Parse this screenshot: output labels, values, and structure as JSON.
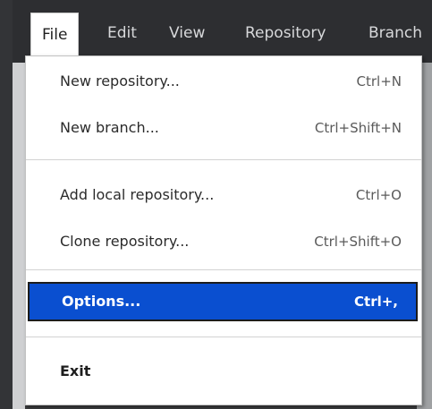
{
  "menubar": {
    "items": [
      {
        "label": "File"
      },
      {
        "label": "Edit"
      },
      {
        "label": "View"
      },
      {
        "label": "Repository"
      },
      {
        "label": "Branch"
      }
    ],
    "active_index": 0
  },
  "file_menu": {
    "items": [
      {
        "label": "New repository...",
        "shortcut": "Ctrl+N"
      },
      {
        "label": "New branch...",
        "shortcut": "Ctrl+Shift+N"
      },
      {
        "label": "Add local repository...",
        "shortcut": "Ctrl+O"
      },
      {
        "label": "Clone repository...",
        "shortcut": "Ctrl+Shift+O"
      },
      {
        "label": "Options...",
        "shortcut": "Ctrl+,"
      },
      {
        "label": "Exit",
        "shortcut": ""
      }
    ],
    "selected_index": 4
  },
  "colors": {
    "highlight": "#0a4fd0",
    "menubar_bg": "#2d2e31"
  }
}
